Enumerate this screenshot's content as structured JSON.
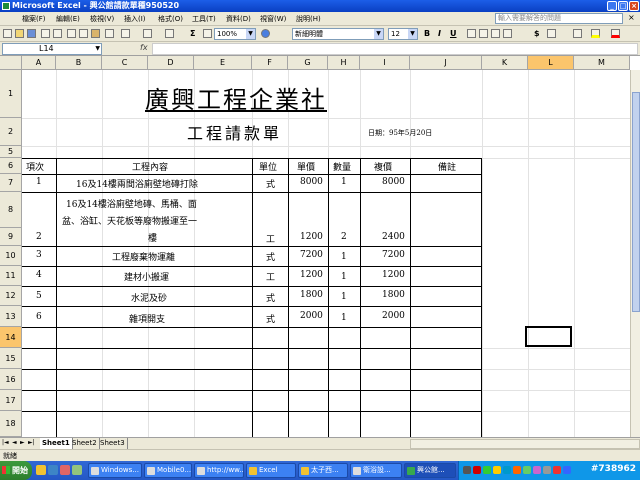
{
  "window": {
    "title": "Microsoft Excel - 興公館請款單種950520"
  },
  "menu": {
    "items": [
      "檔案(F)",
      "編輯(E)",
      "檢視(V)",
      "插入(I)",
      "格式(O)",
      "工具(T)",
      "資料(D)",
      "視窗(W)",
      "說明(H)"
    ],
    "help_placeholder": "輸入需要解答的問題"
  },
  "toolbar": {
    "zoom": "100%",
    "font": "新細明體",
    "font_size": "12",
    "sigma": "Σ",
    "bold": "B",
    "italic": "I",
    "underline": "U",
    "currency": "$"
  },
  "formula": {
    "cell_ref": "L14",
    "fx": "fx",
    "content": ""
  },
  "columns": [
    "A",
    "B",
    "C",
    "D",
    "E",
    "F",
    "G",
    "H",
    "I",
    "J",
    "K",
    "L",
    "M"
  ],
  "rows": [
    "1",
    "2",
    "5",
    "6",
    "7",
    "8",
    "9",
    "10",
    "11",
    "12",
    "13",
    "14",
    "15",
    "16",
    "17",
    "18"
  ],
  "sheet": {
    "company": "廣興工程企業社",
    "doc_title": "工程請款單",
    "date": "日期：95年5月20日",
    "headers": {
      "no": "項次",
      "item": "工程內容",
      "unit": "單位",
      "price": "單價",
      "qty": "數量",
      "amount": "複價",
      "note": "備註"
    },
    "items": [
      {
        "no": "1",
        "desc": [
          "16及14樓兩間浴廁壁地磚打除"
        ],
        "unit": "式",
        "price": "8000",
        "qty": "1",
        "amount": "8000"
      },
      {
        "no": "2",
        "desc": [
          "16及14樓浴廁壁地磚、馬桶、面",
          "盆、浴缸、天花板等廢物搬運至一",
          "樓"
        ],
        "unit": "工",
        "price": "1200",
        "qty": "2",
        "amount": "2400"
      },
      {
        "no": "3",
        "desc": [
          "工程廢棄物運離"
        ],
        "unit": "式",
        "price": "7200",
        "qty": "1",
        "amount": "7200"
      },
      {
        "no": "4",
        "desc": [
          "建材小搬運"
        ],
        "unit": "工",
        "price": "1200",
        "qty": "1",
        "amount": "1200"
      },
      {
        "no": "5",
        "desc": [
          "水泥及砂"
        ],
        "unit": "式",
        "price": "1800",
        "qty": "1",
        "amount": "1800"
      },
      {
        "no": "6",
        "desc": [
          "雜項開支"
        ],
        "unit": "式",
        "price": "2000",
        "qty": "1",
        "amount": "2000"
      }
    ]
  },
  "tabs": [
    "Sheet1",
    "Sheet2",
    "Sheet3"
  ],
  "status": "就緒",
  "taskbar": {
    "start": "開始",
    "tasks": [
      "Windows...",
      "Mobile0...",
      "http://ww...",
      "Excel",
      "太子西...",
      "衛浴設...",
      "興公館..."
    ],
    "clock": "#738962"
  }
}
